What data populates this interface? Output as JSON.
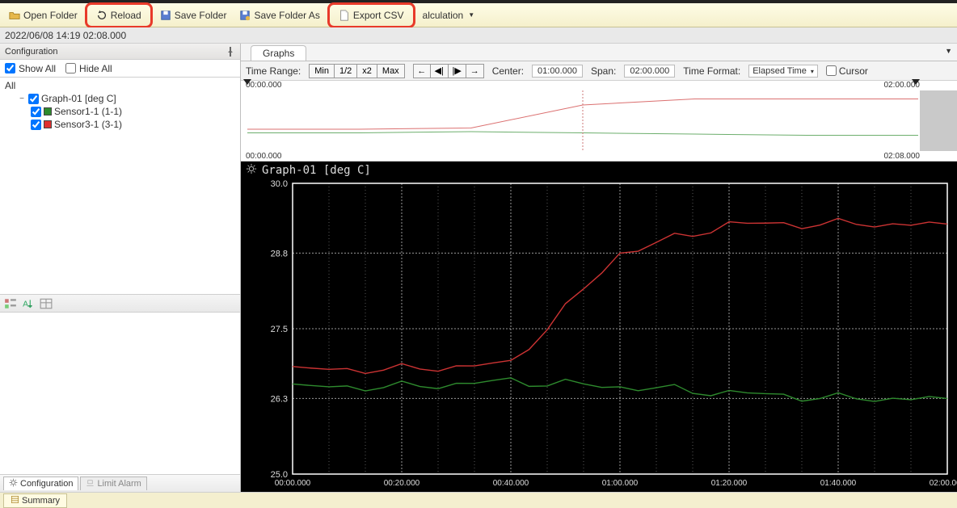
{
  "toolbar": {
    "open_folder": "Open Folder",
    "reload": "Reload",
    "save_folder": "Save Folder",
    "save_folder_as": "Save Folder As",
    "export_csv": "Export CSV",
    "calculation": "alculation"
  },
  "timestamp_bar": "2022/06/08 14:19  02:08.000",
  "config_pane": {
    "title": "Configuration"
  },
  "show_all": "Show All",
  "hide_all": "Hide All",
  "tree": {
    "root": "All",
    "graph": "Graph-01 [deg C]",
    "sensor1": "Sensor1-1 (1-1)",
    "sensor3": "Sensor3-1 (3-1)"
  },
  "side_tabs": {
    "config": "Configuration",
    "limit": "Limit Alarm"
  },
  "summary": "Summary",
  "main_tab": "Graphs",
  "time_ctrl": {
    "label": "Time Range:",
    "min": "Min",
    "half": "1/2",
    "x2": "x2",
    "max": "Max",
    "center_lbl": "Center:",
    "center_val": "01:00.000",
    "span_lbl": "Span:",
    "span_val": "02:00.000",
    "fmt_lbl": "Time Format:",
    "fmt_val": "Elapsed Time",
    "cursor": "Cursor"
  },
  "overview": {
    "tl": "00:00.000",
    "tr": "02:00.000",
    "bl": "00:00.000",
    "br": "02:08.000"
  },
  "chart_title": "Graph-01 [deg C]",
  "chart_data": {
    "type": "line",
    "title": "Graph-01 [deg C]",
    "xlabel": "Elapsed Time",
    "ylabel": "deg C",
    "ylim": [
      25.0,
      30.0
    ],
    "yticks": [
      25.0,
      26.3,
      27.5,
      28.8,
      30.0
    ],
    "x": [
      "00:00.000",
      "00:20.000",
      "00:40.000",
      "01:00.000",
      "01:20.000",
      "01:40.000",
      "02:00.000"
    ],
    "series": [
      {
        "name": "Sensor1-1 (1-1)",
        "color": "#2e8b2e",
        "values": [
          26.5,
          26.5,
          26.6,
          26.5,
          26.4,
          26.3,
          26.3
        ]
      },
      {
        "name": "Sensor3-1 (3-1)",
        "color": "#cc3333",
        "values": [
          26.8,
          26.8,
          26.9,
          28.8,
          29.3,
          29.3,
          29.3
        ]
      }
    ]
  },
  "colors": {
    "sensor1": "#2e8b2e",
    "sensor3": "#e03030"
  }
}
